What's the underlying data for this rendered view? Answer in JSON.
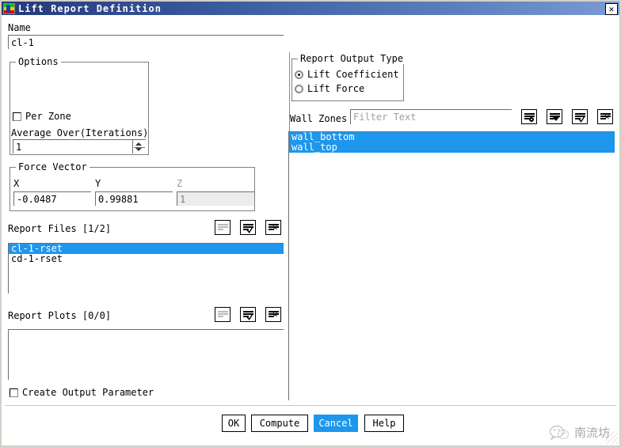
{
  "window": {
    "title": "Lift Report Definition",
    "icon": "fluent-contour-icon",
    "close_label": "✕"
  },
  "name_section": {
    "label": "Name",
    "value": "cl-1",
    "placeholder": ""
  },
  "options": {
    "legend": "Options",
    "per_zone_label": "Per Zone",
    "per_zone_checked": false,
    "average_over_label": "Average Over(Iterations)",
    "average_over_value": "1"
  },
  "force_vector": {
    "legend": "Force Vector",
    "x_label": "X",
    "x_value": "-0.0487",
    "y_label": "Y",
    "y_value": "0.99881",
    "z_label": "Z",
    "z_value": "1",
    "z_disabled": true
  },
  "report_output_type": {
    "legend": "Report Output Type",
    "options": [
      {
        "label": "Lift Coefficient",
        "selected": true
      },
      {
        "label": "Lift Force",
        "selected": false
      }
    ]
  },
  "wall_zones": {
    "label": "Wall Zones",
    "filter_placeholder": "Filter Text",
    "filter_value": "",
    "toolbar": [
      {
        "name": "new-zone-icon",
        "glyph": "dot"
      },
      {
        "name": "filter-dropdown-icon",
        "glyph": "triangle"
      },
      {
        "name": "select-all-icon",
        "glyph": "check"
      },
      {
        "name": "deselect-all-icon",
        "glyph": "x"
      }
    ],
    "items": [
      {
        "label": "wall_bottom",
        "selected": true
      },
      {
        "label": "wall_top",
        "selected": true
      }
    ]
  },
  "report_files": {
    "label": "Report Files [1/2]",
    "toolbar": [
      {
        "name": "list-icon",
        "glyph": "none"
      },
      {
        "name": "select-all-icon",
        "glyph": "check"
      },
      {
        "name": "deselect-all-icon",
        "glyph": "x"
      }
    ],
    "items": [
      {
        "label": "cl-1-rset",
        "selected": true
      },
      {
        "label": "cd-1-rset",
        "selected": false
      }
    ]
  },
  "report_plots": {
    "label": "Report Plots [0/0]",
    "toolbar": [
      {
        "name": "list-icon",
        "glyph": "none"
      },
      {
        "name": "select-all-icon",
        "glyph": "check"
      },
      {
        "name": "deselect-all-icon",
        "glyph": "x"
      }
    ],
    "items": []
  },
  "create_output_parameter": {
    "label": "Create Output Parameter",
    "checked": false
  },
  "buttons": [
    {
      "label": "OK",
      "highlighted": false
    },
    {
      "label": "Compute",
      "highlighted": false
    },
    {
      "label": "Cancel",
      "highlighted": true
    },
    {
      "label": "Help",
      "highlighted": false
    }
  ],
  "watermark": {
    "text": "南流坊",
    "icon": "wechat-icon"
  },
  "colors": {
    "selection_blue": "#1e96ec",
    "title_dark": "#24397a",
    "title_light": "#7a9ad2",
    "dialog_bg": "#ffffff",
    "frame_bg": "#d4d0c8"
  }
}
